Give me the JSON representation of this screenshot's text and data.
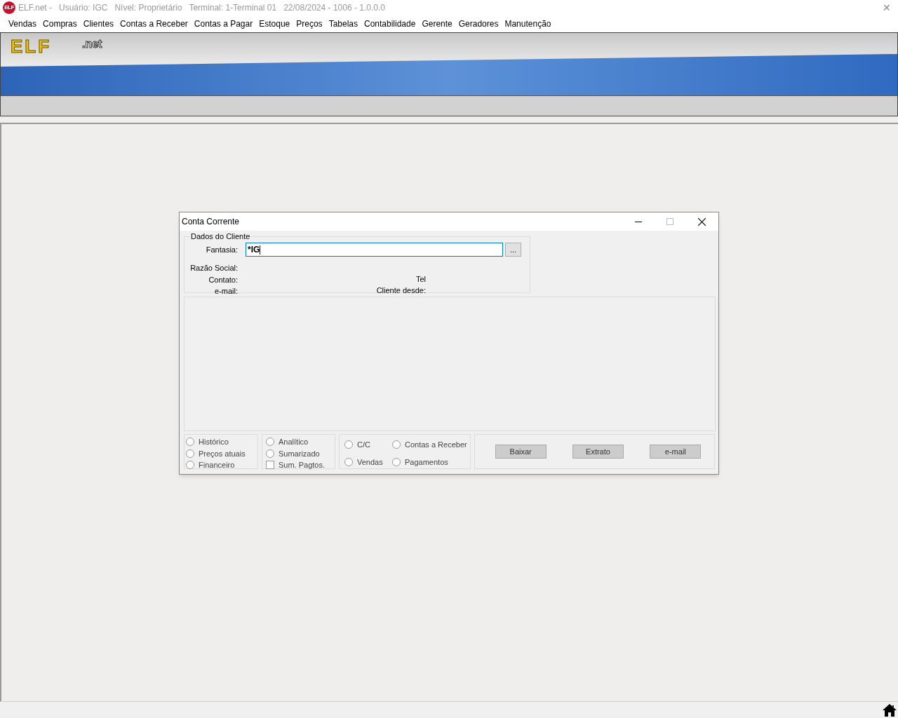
{
  "window": {
    "title_parts": [
      "ELF.net -",
      "Usuário: IGC",
      "Nível: Proprietário",
      "Terminal: 1-Terminal 01",
      "22/08/2024 - 1006 - 1.0.0.0"
    ],
    "app_icon_text": "ELF",
    "close": "✕"
  },
  "menu": [
    "Vendas",
    "Compras",
    "Clientes",
    "Contas a Receber",
    "Contas a Pagar",
    "Estoque",
    "Preços",
    "Tabelas",
    "Contabilidade",
    "Gerente",
    "Geradores",
    "Manutenção"
  ],
  "banner": {
    "logo": "ELF",
    "logo_suffix": ".net"
  },
  "dialog": {
    "title": "Conta Corrente",
    "group_title": "Dados do Cliente",
    "fantasia": {
      "label": "Fantasia:",
      "value": "*IG",
      "browse": "..."
    },
    "fields": [
      {
        "label": "Razão Social:"
      },
      {
        "label": "Contato:",
        "right_label": "Tel"
      },
      {
        "label": "e-mail:",
        "right_label": "Cliente desde:"
      }
    ],
    "options_1": [
      {
        "label": "Histórico",
        "selected": false
      },
      {
        "label": "Preços atuais",
        "selected": false
      },
      {
        "label": "Financeiro",
        "selected": false
      }
    ],
    "options_2": [
      {
        "label": "Analítico",
        "kind": "radio",
        "selected": false
      },
      {
        "label": "Sumarizado",
        "kind": "radio",
        "selected": false
      },
      {
        "label": "Sum. Pagtos.",
        "kind": "checkbox",
        "checked": false
      }
    ],
    "options_3": [
      {
        "label": "C/C",
        "selected": false
      },
      {
        "label": "Contas a Receber",
        "selected": false
      },
      {
        "label": "Vendas",
        "selected": false
      },
      {
        "label": "Pagamentos",
        "selected": false
      }
    ],
    "buttons": [
      "Baixar",
      "Extrato",
      "e-mail"
    ]
  }
}
